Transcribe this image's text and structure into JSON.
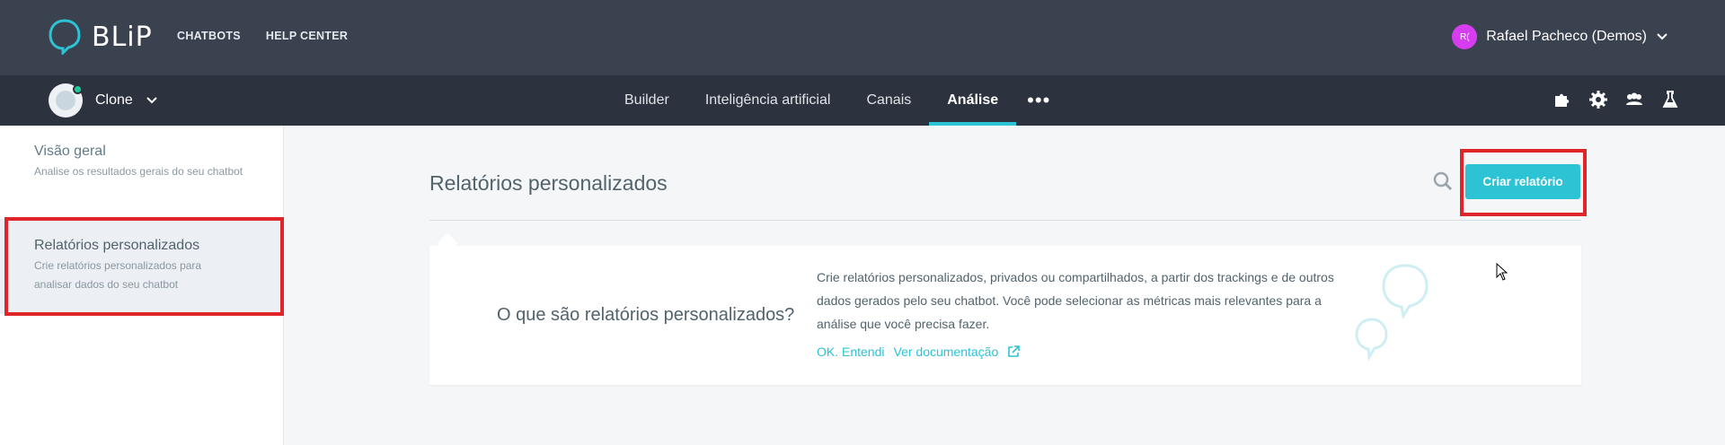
{
  "header": {
    "logo_text": "BLiP",
    "nav": [
      "CHATBOTS",
      "HELP CENTER"
    ],
    "user": {
      "initials": "R(",
      "name": "Rafael Pacheco (Demos)"
    }
  },
  "bot": {
    "name": "Clone"
  },
  "tabs": [
    {
      "label": "Builder"
    },
    {
      "label": "Inteligência artificial"
    },
    {
      "label": "Canais"
    },
    {
      "label": "Análise",
      "active": true
    },
    {
      "label": "•••"
    }
  ],
  "tools": [
    "puzzle-icon",
    "gear-icon",
    "team-icon",
    "flask-icon"
  ],
  "sidebar": {
    "items": [
      {
        "title": "Visão geral",
        "desc": "Analise os resultados gerais do seu chatbot"
      },
      {
        "title": "Relatórios personalizados",
        "desc": "Crie relatórios personalizados para analisar dados do seu chatbot"
      }
    ]
  },
  "main": {
    "title": "Relatórios personalizados",
    "create_button": "Criar relatório",
    "card": {
      "question": "O que são relatórios personalizados?",
      "text": "Crie relatórios personalizados, privados ou compartilhados, a partir dos trackings e de outros dados gerados pelo seu chatbot. Você pode selecionar as métricas mais relevantes para a análise que você precisa fazer.",
      "ok_link": "OK. Entendi",
      "doc_link": "Ver documentação"
    }
  },
  "colors": {
    "accent": "#2cc3d5",
    "highlight": "#e0252a",
    "topbar": "#3a4250",
    "subbar": "#2c333f"
  }
}
